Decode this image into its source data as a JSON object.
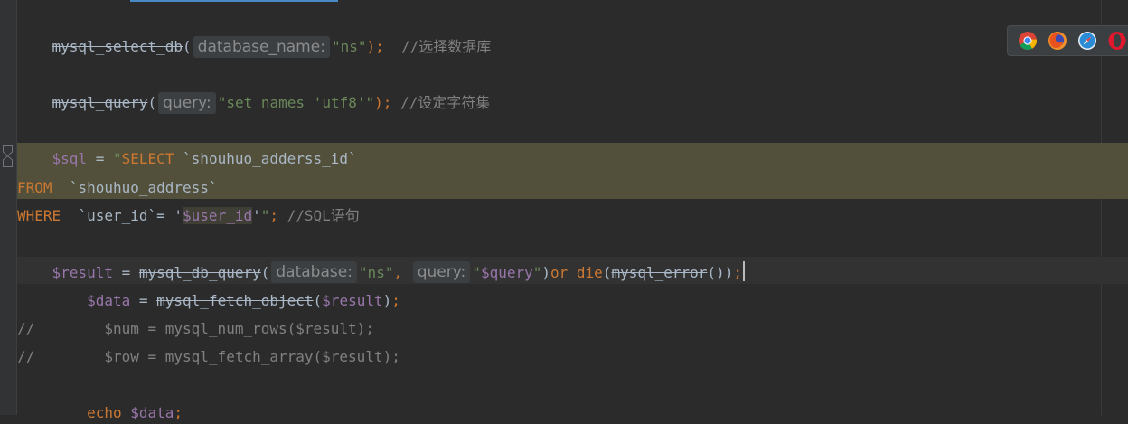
{
  "colors": {
    "background": "#2b2b2b",
    "default_text": "#a9b7c6",
    "keyword": "#cc7832",
    "string": "#6a8759",
    "variable": "#9876aa",
    "comment": "#808080",
    "sql_injection_highlight": "#52503a",
    "tab_indicator": "#4a88c7"
  },
  "browser_icons": [
    "chrome-icon",
    "firefox-icon",
    "safari-icon",
    "opera-icon"
  ],
  "lines": [
    {
      "id": "line-select-db",
      "tokens": [
        {
          "t": "    ",
          "c": "def"
        },
        {
          "t": "mysql_select_db",
          "c": "def",
          "strike": true
        },
        {
          "t": "(",
          "c": "def"
        },
        {
          "hint": "database_name:"
        },
        {
          "t": "\"ns\"",
          "c": "str"
        },
        {
          "t": ");  ",
          "c": "kw"
        },
        {
          "t": "//选择数据库",
          "c": "cmt"
        }
      ]
    },
    {
      "id": "line-set-names",
      "tokens": [
        {
          "t": "    ",
          "c": "def"
        },
        {
          "t": "mysql_query",
          "c": "def",
          "strike": true
        },
        {
          "t": "(",
          "c": "def"
        },
        {
          "hint": "query:"
        },
        {
          "t": "\"set names 'utf8'\"",
          "c": "str"
        },
        {
          "t": "); ",
          "c": "kw"
        },
        {
          "t": "//设定字符集",
          "c": "cmt"
        }
      ]
    },
    {
      "id": "line-sql-1",
      "tokens": [
        {
          "t": "    ",
          "c": "def"
        },
        {
          "t": "$sql",
          "c": "var"
        },
        {
          "t": " = ",
          "c": "def"
        },
        {
          "t": "\"",
          "c": "str"
        },
        {
          "t": "SELECT",
          "c": "kw",
          "hl": true
        },
        {
          "t": " `shouhuo_adderss_id`",
          "c": "def",
          "hl": true
        }
      ]
    },
    {
      "id": "line-sql-2",
      "tokens": [
        {
          "t": "FROM",
          "c": "kw",
          "hl": true
        },
        {
          "t": "  `shouhuo_address`",
          "c": "def",
          "hl": true
        }
      ]
    },
    {
      "id": "line-sql-3",
      "tokens": [
        {
          "t": "WHERE",
          "c": "kw",
          "hl": true
        },
        {
          "t": "  `user_id`= '",
          "c": "def",
          "hl": true
        },
        {
          "t": "$user_id",
          "c": "var",
          "hlvar": true
        },
        {
          "t": "'",
          "c": "def",
          "hl": true
        },
        {
          "t": "\"",
          "c": "str"
        },
        {
          "t": "; ",
          "c": "kw"
        },
        {
          "t": "//SQL语句",
          "c": "cmt"
        }
      ]
    },
    {
      "id": "line-result",
      "tokens": [
        {
          "t": "    ",
          "c": "def"
        },
        {
          "t": "$result",
          "c": "var"
        },
        {
          "t": " = ",
          "c": "def"
        },
        {
          "t": "mysql_db_query",
          "c": "def",
          "strike": true
        },
        {
          "t": "(",
          "c": "def"
        },
        {
          "hint": "database:"
        },
        {
          "t": "\"ns\"",
          "c": "str"
        },
        {
          "t": ", ",
          "c": "kw"
        },
        {
          "hint": "query:"
        },
        {
          "t": "\"",
          "c": "str"
        },
        {
          "t": "$query",
          "c": "var"
        },
        {
          "t": "\"",
          "c": "str"
        },
        {
          "t": ")",
          "c": "def"
        },
        {
          "t": "or die",
          "c": "kw"
        },
        {
          "t": "(",
          "c": "def"
        },
        {
          "t": "mysql_error",
          "c": "def",
          "strike": true
        },
        {
          "t": "())",
          "c": "def"
        },
        {
          "t": ";",
          "c": "kw"
        },
        {
          "cursor": true
        }
      ]
    },
    {
      "id": "line-data",
      "tokens": [
        {
          "t": "        ",
          "c": "def"
        },
        {
          "t": "$data",
          "c": "var"
        },
        {
          "t": " = ",
          "c": "def"
        },
        {
          "t": "mysql_fetch_object",
          "c": "def",
          "strike": true
        },
        {
          "t": "(",
          "c": "def"
        },
        {
          "t": "$result",
          "c": "var"
        },
        {
          "t": ")",
          "c": "def"
        },
        {
          "t": ";",
          "c": "kw"
        }
      ]
    },
    {
      "id": "line-num-comment",
      "tokens": [
        {
          "t": "//        $num = mysql_num_rows($result);",
          "c": "cmt"
        }
      ]
    },
    {
      "id": "line-row-comment",
      "tokens": [
        {
          "t": "//        $row = mysql_fetch_array($result);",
          "c": "cmt"
        }
      ]
    },
    {
      "id": "line-blank",
      "tokens": []
    },
    {
      "id": "line-echo",
      "tokens": [
        {
          "t": "        ",
          "c": "def"
        },
        {
          "t": "echo",
          "c": "kw"
        },
        {
          "t": " ",
          "c": "def"
        },
        {
          "t": "$data",
          "c": "var"
        },
        {
          "t": ";",
          "c": "kw"
        }
      ]
    }
  ]
}
